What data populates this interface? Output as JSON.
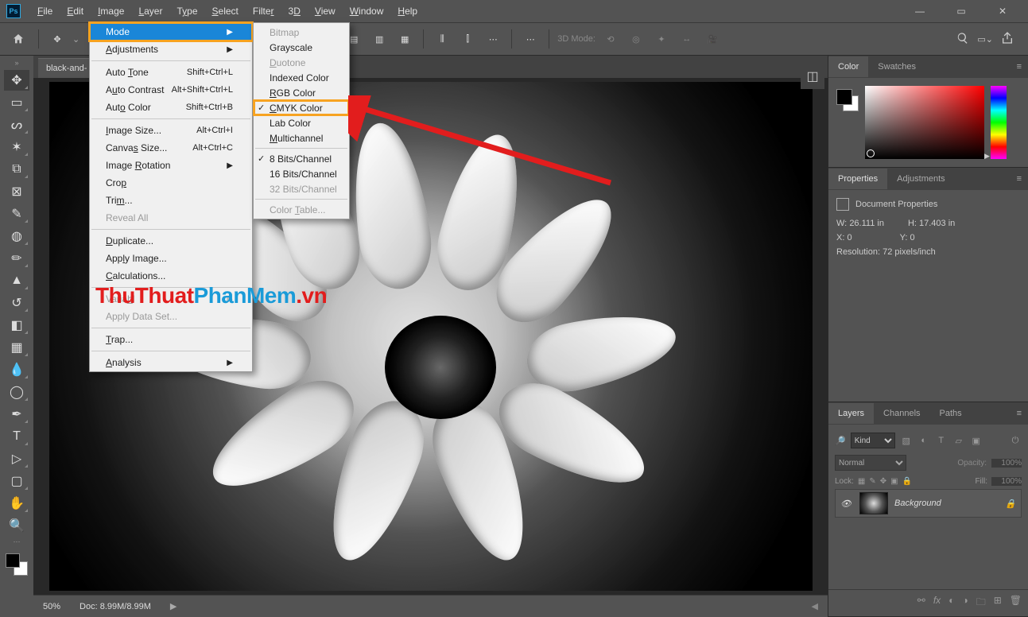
{
  "menubar": [
    "File",
    "Edit",
    "Image",
    "Layer",
    "Type",
    "Select",
    "Filter",
    "3D",
    "View",
    "Window",
    "Help"
  ],
  "optbar": {
    "mode3d": "3D Mode:"
  },
  "doctab": "black-and-",
  "image_menu": {
    "mode": "Mode",
    "adjustments": "Adjustments",
    "auto_tone": "Auto Tone",
    "auto_tone_sc": "Shift+Ctrl+L",
    "auto_contrast": "Auto Contrast",
    "auto_contrast_sc": "Alt+Shift+Ctrl+L",
    "auto_color": "Auto Color",
    "auto_color_sc": "Shift+Ctrl+B",
    "image_size": "Image Size...",
    "image_size_sc": "Alt+Ctrl+I",
    "canvas_size": "Canvas Size...",
    "canvas_size_sc": "Alt+Ctrl+C",
    "image_rotation": "Image Rotation",
    "crop": "Crop",
    "trim": "Trim...",
    "reveal_all": "Reveal All",
    "duplicate": "Duplicate...",
    "apply_image": "Apply Image...",
    "calculations": "Calculations...",
    "variables": "Variables",
    "apply_data_set": "Apply Data Set...",
    "trap": "Trap...",
    "analysis": "Analysis"
  },
  "mode_menu": {
    "bitmap": "Bitmap",
    "grayscale": "Grayscale",
    "duotone": "Duotone",
    "indexed": "Indexed Color",
    "rgb": "RGB Color",
    "cmyk": "CMYK Color",
    "lab": "Lab Color",
    "multichannel": "Multichannel",
    "b8": "8 Bits/Channel",
    "b16": "16 Bits/Channel",
    "b32": "32 Bits/Channel",
    "color_table": "Color Table..."
  },
  "panels": {
    "color": "Color",
    "swatches": "Swatches",
    "properties": "Properties",
    "p_adjust": "Adjustments",
    "doc_props": "Document Properties",
    "w_lbl": "W:",
    "w_val": "26.111 in",
    "h_lbl": "H:",
    "h_val": "17.403 in",
    "x_lbl": "X:",
    "x_val": "0",
    "y_lbl": "Y:",
    "y_val": "0",
    "res": "Resolution: 72 pixels/inch",
    "layers": "Layers",
    "channels": "Channels",
    "paths": "Paths",
    "kind": "Kind",
    "normal": "Normal",
    "opacity": "Opacity:",
    "opc_val": "100%",
    "lock": "Lock:",
    "fill": "Fill:",
    "fill_val": "100%",
    "bg_layer": "Background"
  },
  "status": {
    "zoom": "50%",
    "doc": "Doc: 8.99M/8.99M"
  },
  "watermark": {
    "a": "ThuThuat",
    "b": "PhanMem",
    "c": ".vn"
  }
}
